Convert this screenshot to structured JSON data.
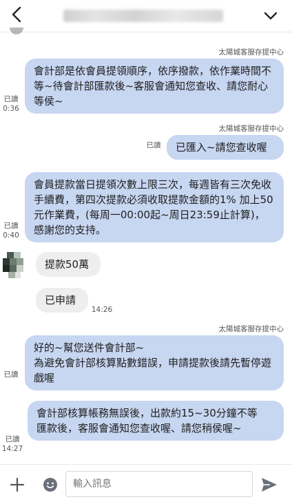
{
  "header": {
    "back_icon": "chevron-left-icon",
    "menu_icon": "chevron-down-icon"
  },
  "messages": [
    {
      "sender": "太陽城客服存提中心",
      "text": "會計部是依會員提領順序，依序撥款，依作業時間不等~待會計部匯款後~客服會通知您查收、請您耐心等侯~",
      "read": "已讀",
      "time": "0:36"
    },
    {
      "sender": "太陽城客服存提中心",
      "text": "已匯入~請您查收喔",
      "read": "已讀",
      "time": ""
    },
    {
      "sender": "",
      "text": "會員提款當日提領次數上限三次，每週皆有三次免收手續費，第四次提款必須收取提款金額的1% 加上50元作業費，(每周一00:00起~周日23:59止計算)，感謝您的支持。",
      "read": "已讀",
      "time": "0:40"
    },
    {
      "text": "提款50萬"
    },
    {
      "text": "已申請",
      "time": "14:26"
    },
    {
      "sender": "太陽城客服存提中心",
      "text": "好的~幫您送件會計部~\n為避免會計部核算點數錯誤，申請提款後請先暫停遊戲喔",
      "read": "已讀",
      "time": ""
    },
    {
      "text": "會計部核算帳務無誤後，出款約15~30分鐘不等\n匯款後，客服會通知您查收喔、請您稍侯喔~",
      "read": "已讀",
      "time": "14:27"
    }
  ],
  "composer": {
    "placeholder": "輸入訊息",
    "add_icon": "plus-icon",
    "sticker_icon": "smiley-icon",
    "send_icon": "send-icon"
  },
  "colors": {
    "outgoing_bubble": "#c7d6f1",
    "incoming_bubble": "#eeeeee"
  }
}
